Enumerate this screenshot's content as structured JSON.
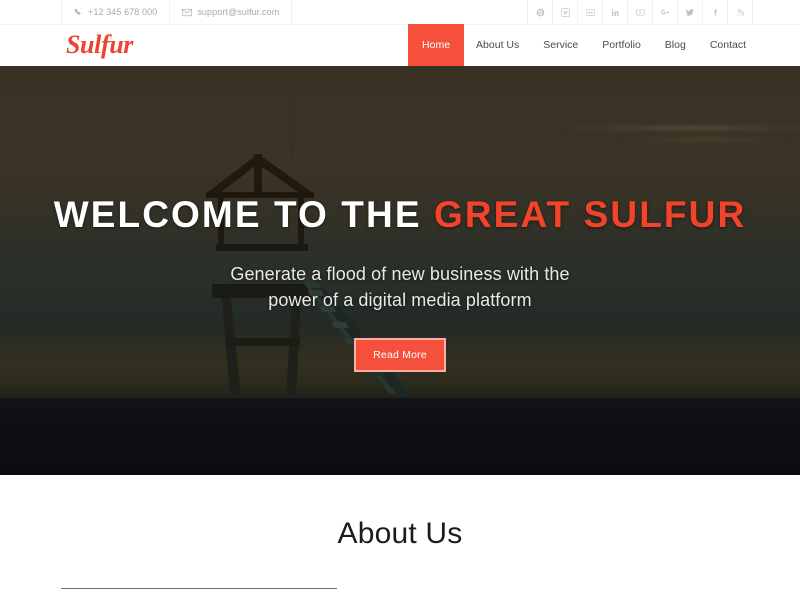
{
  "topbar": {
    "phone": {
      "icon": "phone-icon",
      "text": "+12 345 678 000"
    },
    "email": {
      "icon": "envelope-icon",
      "text": "support@sulfur.com"
    },
    "social": [
      {
        "name": "skype-icon",
        "label": "Skype"
      },
      {
        "name": "vimeo-icon",
        "label": "Vimeo"
      },
      {
        "name": "flickr-icon",
        "label": "Flickr"
      },
      {
        "name": "linkedin-icon",
        "label": "LinkedIn"
      },
      {
        "name": "youtube-icon",
        "label": "YouTube"
      },
      {
        "name": "google-plus-icon",
        "label": "Google Plus"
      },
      {
        "name": "twitter-icon",
        "label": "Twitter"
      },
      {
        "name": "facebook-icon",
        "label": "Facebook"
      },
      {
        "name": "rss-icon",
        "label": "RSS"
      }
    ]
  },
  "header": {
    "logo": "Sulfur",
    "nav": [
      {
        "label": "Home",
        "active": true
      },
      {
        "label": "About Us",
        "active": false
      },
      {
        "label": "Service",
        "active": false
      },
      {
        "label": "Portfolio",
        "active": false
      },
      {
        "label": "Blog",
        "active": false
      },
      {
        "label": "Contact",
        "active": false
      }
    ]
  },
  "hero": {
    "title_white": "WELCOME TO THE",
    "title_accent": "GREAT SULFUR",
    "subtitle_line1": "Generate a flood of new business with the",
    "subtitle_line2": "power of a digital media platform",
    "button_label": "Read More",
    "background_description": "lifeguard tower silhouette on a beach at dusk"
  },
  "about": {
    "title": "About Us"
  },
  "colors": {
    "accent": "#f4503c",
    "accent_text": "#f4432b",
    "logo": "#ef4130",
    "topbar_text": "#a9a9a9",
    "nav_text": "#4b4b4b",
    "heading": "#1c1c1c"
  }
}
